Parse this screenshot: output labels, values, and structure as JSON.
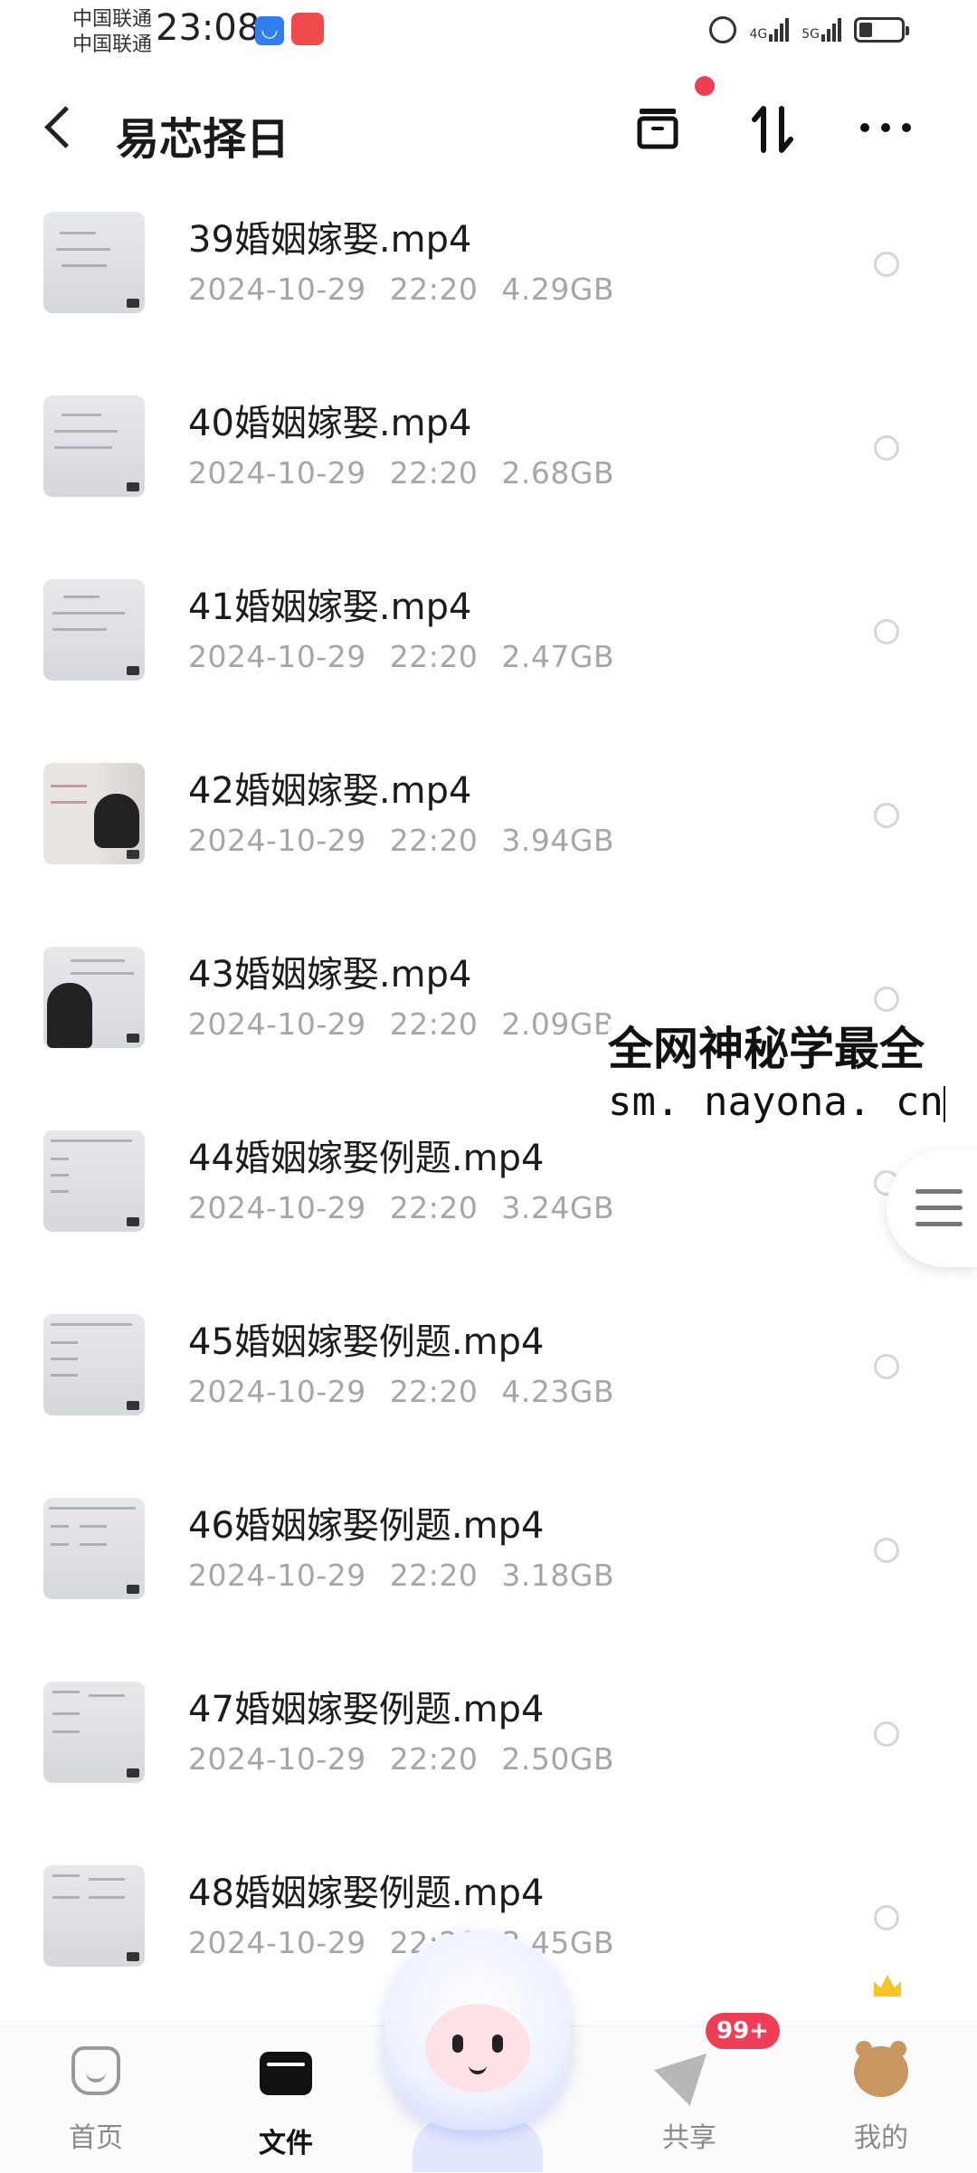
{
  "status_bar": {
    "carrier1": "中国联通",
    "carrier2": "中国联通",
    "time": "23:08",
    "net1": "4G",
    "net2": "5G"
  },
  "header": {
    "title": "易芯择日"
  },
  "files": [
    {
      "name": "39婚姻嫁娶.mp4",
      "date": "2024-10-29",
      "time": "22:20",
      "size": "4.29GB"
    },
    {
      "name": "40婚姻嫁娶.mp4",
      "date": "2024-10-29",
      "time": "22:20",
      "size": "2.68GB"
    },
    {
      "name": "41婚姻嫁娶.mp4",
      "date": "2024-10-29",
      "time": "22:20",
      "size": "2.47GB"
    },
    {
      "name": "42婚姻嫁娶.mp4",
      "date": "2024-10-29",
      "time": "22:20",
      "size": "3.94GB"
    },
    {
      "name": "43婚姻嫁娶.mp4",
      "date": "2024-10-29",
      "time": "22:20",
      "size": "2.09GB"
    },
    {
      "name": "44婚姻嫁娶例题.mp4",
      "date": "2024-10-29",
      "time": "22:20",
      "size": "3.24GB"
    },
    {
      "name": "45婚姻嫁娶例题.mp4",
      "date": "2024-10-29",
      "time": "22:20",
      "size": "4.23GB"
    },
    {
      "name": "46婚姻嫁娶例题.mp4",
      "date": "2024-10-29",
      "time": "22:20",
      "size": "3.18GB"
    },
    {
      "name": "47婚姻嫁娶例题.mp4",
      "date": "2024-10-29",
      "time": "22:20",
      "size": "2.50GB"
    },
    {
      "name": "48婚姻嫁娶例题.mp4",
      "date": "2024-10-29",
      "time": "22:20",
      "size": "3.45GB"
    }
  ],
  "watermark": {
    "line1": "全网神秘学最全",
    "line2": "sm. nayona. cn"
  },
  "bottom_nav": {
    "home": "首页",
    "files": "文件",
    "share": "共享",
    "mine": "我的",
    "share_badge": "99+"
  },
  "colors": {
    "accent_red": "#f13e57",
    "meta_gray": "#a6a6a6"
  }
}
